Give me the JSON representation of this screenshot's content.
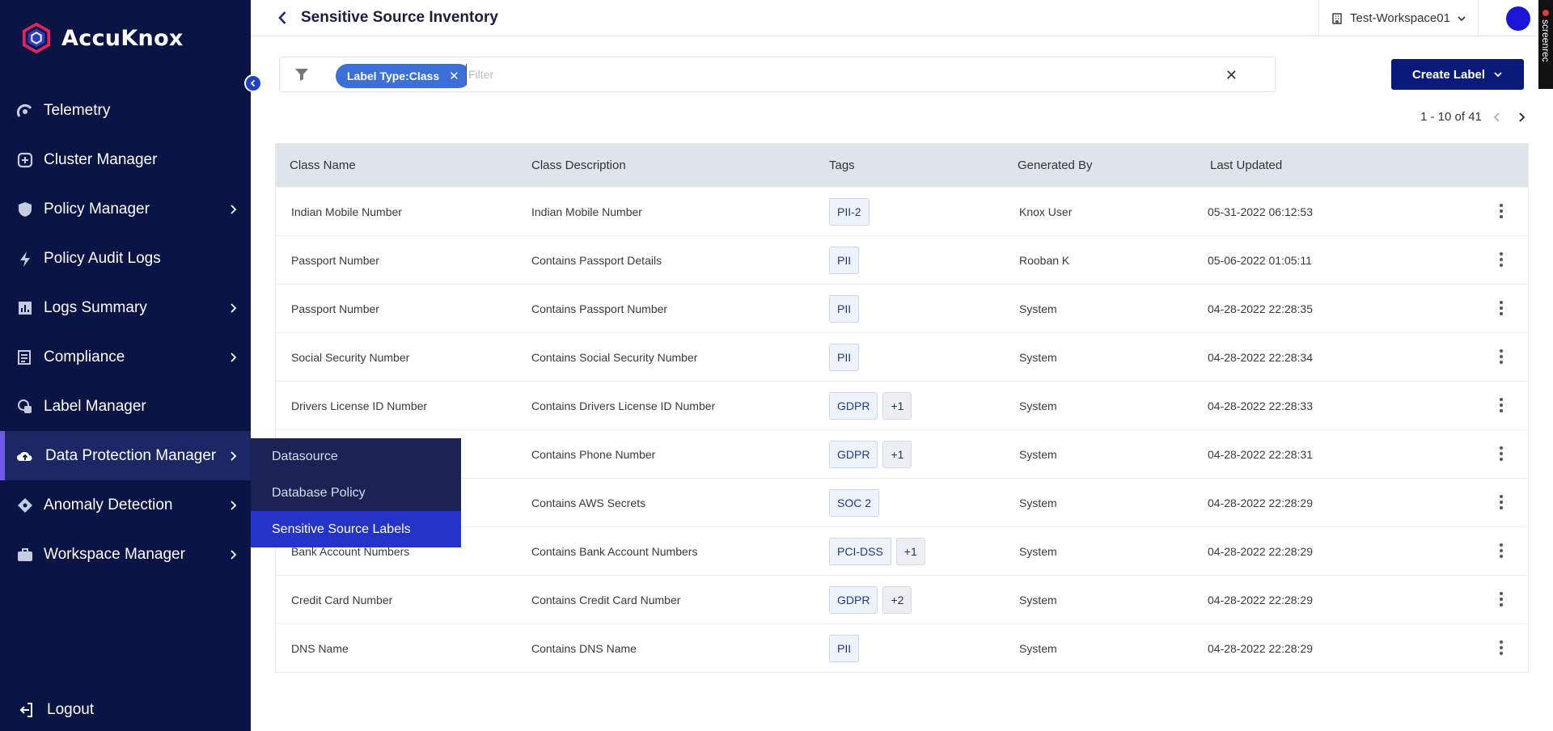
{
  "app": {
    "logo_text": "AccuKnox",
    "page_title": "Sensitive Source Inventory",
    "workspace": "Test-Workspace01",
    "screenrec_label": "screenrec"
  },
  "sidebar": {
    "items": [
      {
        "label": "Telemetry",
        "icon": "telemetry-icon",
        "chevron": false
      },
      {
        "label": "Cluster Manager",
        "icon": "cluster-icon",
        "chevron": false
      },
      {
        "label": "Policy Manager",
        "icon": "shield-icon",
        "chevron": true
      },
      {
        "label": "Policy Audit Logs",
        "icon": "bolt-icon",
        "chevron": false
      },
      {
        "label": "Logs Summary",
        "icon": "bar-chart-icon",
        "chevron": true
      },
      {
        "label": "Compliance",
        "icon": "compliance-icon",
        "chevron": true
      },
      {
        "label": "Label Manager",
        "icon": "label-icon",
        "chevron": false
      },
      {
        "label": "Data Protection Manager",
        "icon": "cloud-upload-icon",
        "chevron": true,
        "active": true
      },
      {
        "label": "Anomaly Detection",
        "icon": "anomaly-icon",
        "chevron": true
      },
      {
        "label": "Workspace Manager",
        "icon": "briefcase-icon",
        "chevron": true
      }
    ],
    "logout": "Logout",
    "flyout": [
      "Datasource",
      "Database Policy",
      "Sensitive Source Labels"
    ]
  },
  "filter": {
    "chip": "Label Type:Class",
    "placeholder": "Filter"
  },
  "create_label": "Create Label",
  "pager": "1 - 10 of 41",
  "table": {
    "headers": [
      "Class Name",
      "Class Description",
      "Tags",
      "Generated By",
      "Last Updated"
    ],
    "rows": [
      {
        "name": "Indian Mobile Number",
        "desc": "Indian Mobile Number",
        "tags": [
          "PII-2"
        ],
        "more": "",
        "by": "Knox User",
        "updated": "05-31-2022 06:12:53"
      },
      {
        "name": "Passport Number",
        "desc": "Contains Passport Details",
        "tags": [
          "PII"
        ],
        "more": "",
        "by": "Rooban K",
        "updated": "05-06-2022 01:05:11"
      },
      {
        "name": "Passport Number",
        "desc": "Contains Passport Number",
        "tags": [
          "PII"
        ],
        "more": "",
        "by": "System",
        "updated": "04-28-2022 22:28:35"
      },
      {
        "name": "Social Security Number",
        "desc": "Contains Social Security Number",
        "tags": [
          "PII"
        ],
        "more": "",
        "by": "System",
        "updated": "04-28-2022 22:28:34"
      },
      {
        "name": "Drivers License ID Number",
        "desc": "Contains Drivers License ID Number",
        "tags": [
          "GDPR"
        ],
        "more": "+1",
        "by": "System",
        "updated": "04-28-2022 22:28:33"
      },
      {
        "name": "",
        "desc": "Contains Phone Number",
        "tags": [
          "GDPR"
        ],
        "more": "+1",
        "by": "System",
        "updated": "04-28-2022 22:28:31"
      },
      {
        "name": "",
        "desc": "Contains AWS Secrets",
        "tags": [
          "SOC 2"
        ],
        "more": "",
        "by": "System",
        "updated": "04-28-2022 22:28:29"
      },
      {
        "name": "Bank Account Numbers",
        "desc": "Contains Bank Account Numbers",
        "tags": [
          "PCI-DSS"
        ],
        "more": "+1",
        "by": "System",
        "updated": "04-28-2022 22:28:29"
      },
      {
        "name": "Credit Card Number",
        "desc": "Contains Credit Card Number",
        "tags": [
          "GDPR"
        ],
        "more": "+2",
        "by": "System",
        "updated": "04-28-2022 22:28:29"
      },
      {
        "name": "DNS Name",
        "desc": "Contains DNS Name",
        "tags": [
          "PII"
        ],
        "more": "",
        "by": "System",
        "updated": "04-28-2022 22:28:29"
      }
    ]
  },
  "colors": {
    "sidebar_bg": "#0a1445",
    "accent": "#2434c8",
    "primary_button": "#0a1a7a",
    "chip": "#3d6fd8"
  }
}
